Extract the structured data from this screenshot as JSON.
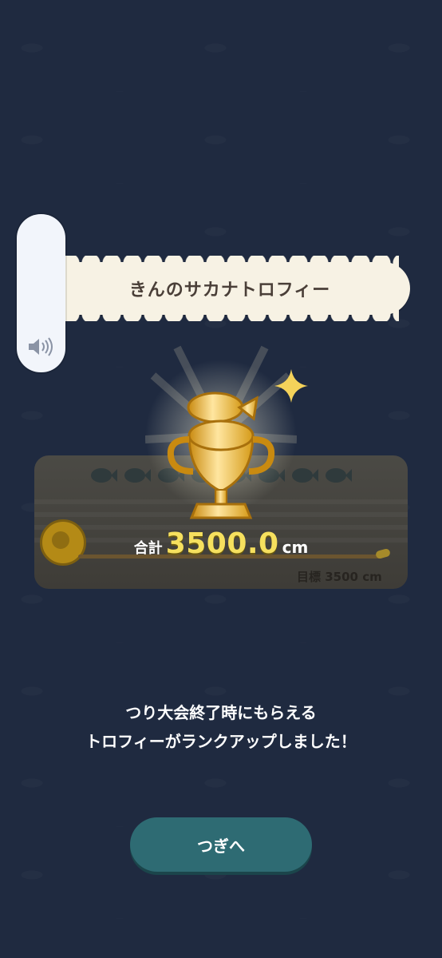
{
  "trophy": {
    "name": "きんのサカナトロフィー",
    "total_label": "合計",
    "total_value": "3500.0",
    "total_unit": "cm",
    "goal_text": "目標 3500 cm"
  },
  "message": {
    "line1": "つり大会終了時にもらえる",
    "line2": "トロフィーがランクアップしました！"
  },
  "buttons": {
    "next_label": "つぎへ"
  },
  "colors": {
    "background": "#1f2a40",
    "banner": "#f7f2e4",
    "button": "#2e6b73",
    "total_value": "#f6e05e"
  },
  "icons": [
    "volume-icon",
    "sparkle-icon",
    "gold-fish-trophy-icon",
    "fish-icon",
    "tape-measure-icon"
  ]
}
